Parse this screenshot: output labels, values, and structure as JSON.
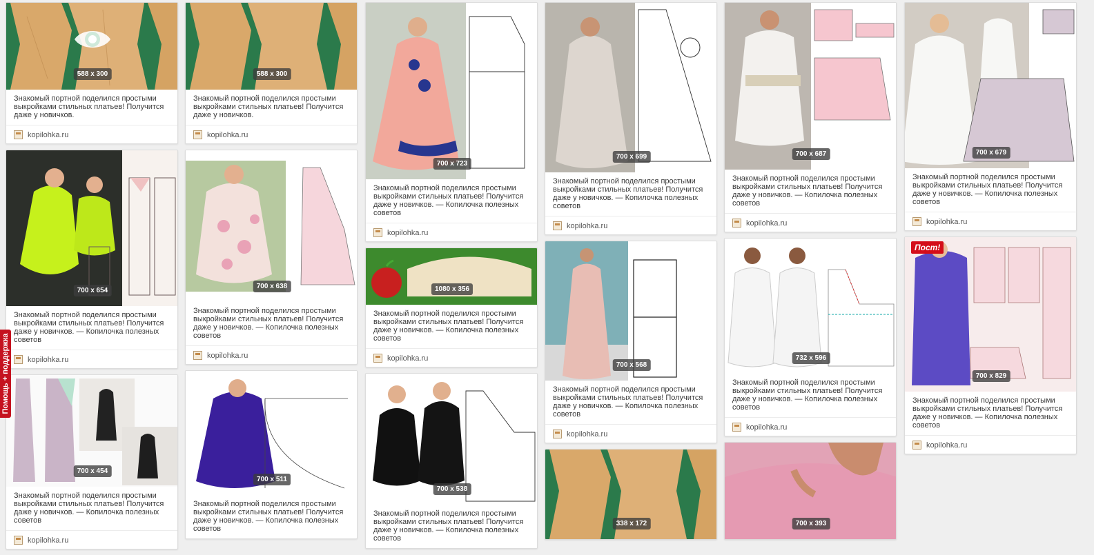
{
  "caption_short": "Знакомый портной поделился простыми выкройками стильных платьев! Получится даже у новичков.",
  "caption_long": "Знакомый портной поделился простыми выкройками стильных платьев! Получится даже у новичков. — Копилочка полезных советов",
  "source": "kopilohka.ru",
  "help_tab": "Помощь + поддержка",
  "post_badge": "Пост!",
  "cards": [
    {
      "size": "588 x 300"
    },
    {
      "size": "700 x 654"
    },
    {
      "size": "700 x 454"
    },
    {
      "size": "588 x 300"
    },
    {
      "size": "700 x 638"
    },
    {
      "size": "700 x 511"
    },
    {
      "size": "700 x 723"
    },
    {
      "size": "1080 x 356"
    },
    {
      "size": "700 x 538"
    },
    {
      "size": "700 x 699"
    },
    {
      "size": "700 x 568"
    },
    {
      "size": "338 x 172"
    },
    {
      "size": "700 x 687"
    },
    {
      "size": "732 x 596"
    },
    {
      "size": "700 x 393"
    },
    {
      "size": "700 x 679"
    },
    {
      "size": "700 x 829"
    }
  ]
}
